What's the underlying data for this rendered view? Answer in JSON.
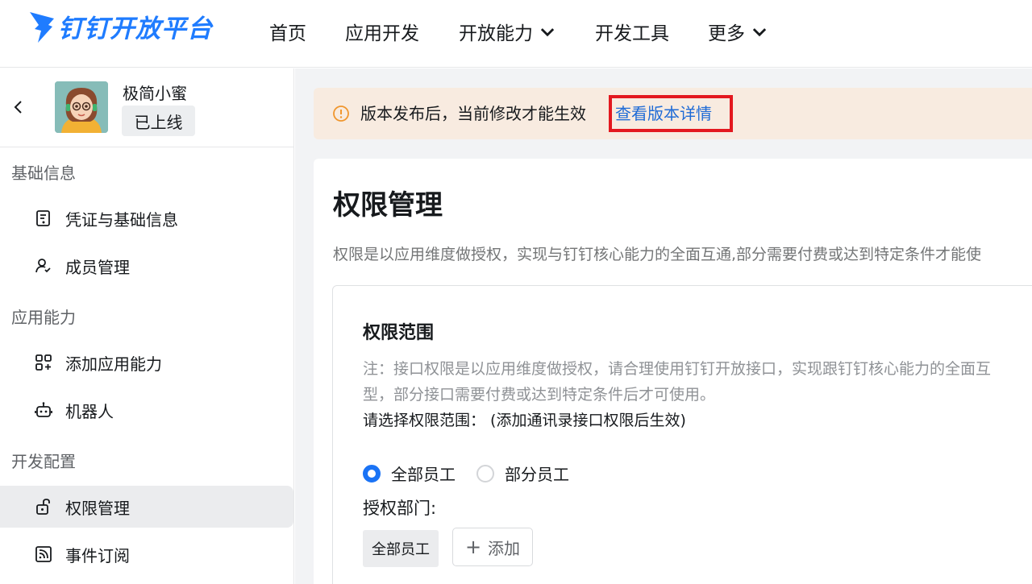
{
  "brand": {
    "name": "钉钉开放平台",
    "color": "#1f7cff"
  },
  "nav": [
    {
      "label": "首页"
    },
    {
      "label": "应用开发"
    },
    {
      "label": "开放能力",
      "has_dropdown": true
    },
    {
      "label": "开发工具"
    },
    {
      "label": "更多",
      "has_dropdown": true
    }
  ],
  "app": {
    "name": "极简小蜜",
    "status": "已上线"
  },
  "sidebar": {
    "sections": [
      {
        "label": "基础信息"
      },
      {
        "label": "应用能力"
      },
      {
        "label": "开发配置"
      }
    ],
    "items": [
      {
        "label": "凭证与基础信息",
        "icon": "credential-icon"
      },
      {
        "label": "成员管理",
        "icon": "member-icon"
      },
      {
        "label": "添加应用能力",
        "icon": "add-app-icon"
      },
      {
        "label": "机器人",
        "icon": "robot-icon"
      },
      {
        "label": "权限管理",
        "icon": "unlock-icon",
        "active": true
      },
      {
        "label": "事件订阅",
        "icon": "rss-icon"
      }
    ]
  },
  "notice": {
    "text": "版本发布后，当前修改才能生效",
    "link": "查看版本详情",
    "bg_color": "#f8ebe0"
  },
  "page": {
    "title": "权限管理",
    "description": "权限是以应用维度做授权，实现与钉钉核心能力的全面互通,部分需要付费或达到特定条件才能使"
  },
  "scope": {
    "title": "权限范围",
    "note_line1": "注：接口权限是以应用维度做授权，请合理使用钉钉开放接口，实现跟钉钉核心能力的全面互",
    "note_line2": "型，部分接口需要付费或达到特定条件后才可使用。",
    "question": "请选择权限范围： (添加通讯录接口权限后生效)",
    "options": [
      {
        "label": "全部员工",
        "selected": true
      },
      {
        "label": "部分员工",
        "selected": false
      }
    ],
    "dept_label": "授权部门:",
    "dept_tag": "全部员工",
    "add_label": "添加"
  }
}
